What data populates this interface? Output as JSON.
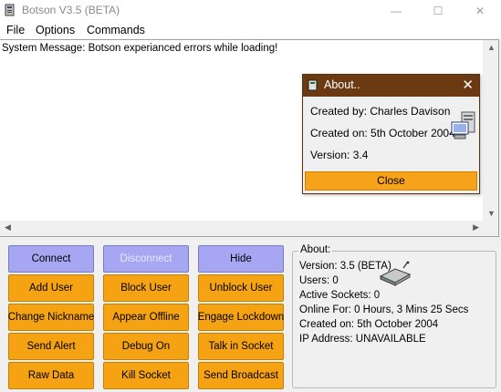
{
  "window": {
    "title": "Botson V3.5 (BETA)",
    "controls": {
      "minimize": "—",
      "maximize": "☐",
      "close": "✕"
    }
  },
  "menu": {
    "file": "File",
    "options": "Options",
    "commands": "Commands"
  },
  "log": {
    "lines": [
      "System Message: Botson experianced errors while loading!"
    ]
  },
  "about_dialog": {
    "title": "About..",
    "close_glyph": "✕",
    "created_by": "Created by: Charles Davison",
    "created_on": "Created on: 5th October 2004",
    "version": "Version: 3.4",
    "close_button": "Close",
    "title_color": "#6b3a12"
  },
  "buttons": {
    "connect": "Connect",
    "disconnect": "Disconnect",
    "hide": "Hide",
    "add_user": "Add User",
    "block_user": "Block User",
    "unblock_user": "Unblock User",
    "change_nickname": "Change Nickname",
    "appear_offline": "Appear Offline",
    "engage_lockdown": "Engage Lockdown",
    "send_alert": "Send Alert",
    "debug_on": "Debug On",
    "talk_in_socket": "Talk in Socket",
    "raw_data": "Raw Data",
    "kill_socket": "Kill Socket",
    "send_broadcast": "Send Broadcast"
  },
  "info": {
    "legend": "About:",
    "version": "Version: 3.5 (BETA)",
    "users": "Users:   0",
    "active_sockets": "Active Sockets:  0",
    "online_for": "Online For: 0   Hours,   3     Mins    25 Secs",
    "created_on": "Created on: 5th October 2004",
    "ip_address": "IP Address:   UNAVAILABLE"
  },
  "colors": {
    "primary_button": "#a6a6f2",
    "action_button": "#f5a313"
  }
}
